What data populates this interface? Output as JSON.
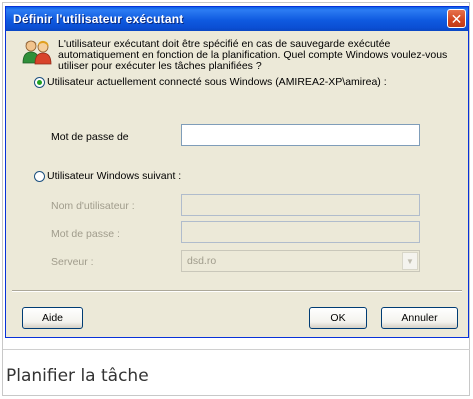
{
  "dialog": {
    "title": "Définir l'utilisateur exécutant",
    "close_glyph": "✕",
    "intro_text": "L'utilisateur exécutant doit être spécifié en cas de sauvegarde exécutée automatiquement en fonction de la planification. Quel compte Windows voulez-vous utiliser pour exécuter les tâches planifiées ?",
    "option_current_user": {
      "label": "Utilisateur actuellement connecté sous Windows (AMIREA2-XP\\amirea) :",
      "selected": true
    },
    "password_for_current": {
      "label": "Mot de passe de",
      "value": ""
    },
    "option_other_user": {
      "label": "Utilisateur Windows suivant :",
      "selected": false
    },
    "username": {
      "label": "Nom d'utilisateur :",
      "value": ""
    },
    "password": {
      "label": "Mot de passe :",
      "value": ""
    },
    "server": {
      "label": "Serveur :",
      "value": "dsd.ro"
    },
    "buttons": {
      "help": "Aide",
      "ok": "OK",
      "cancel": "Annuler"
    }
  },
  "caption": "Planifier la tâche",
  "colors": {
    "titlebar": "#0b4fd4",
    "dialog_bg": "#ece9d8",
    "close_button": "#d2451f",
    "radio_dot": "#21a121"
  },
  "icons": {
    "users": "users-icon",
    "close": "close-icon",
    "dropdown": "chevron-down-icon"
  }
}
